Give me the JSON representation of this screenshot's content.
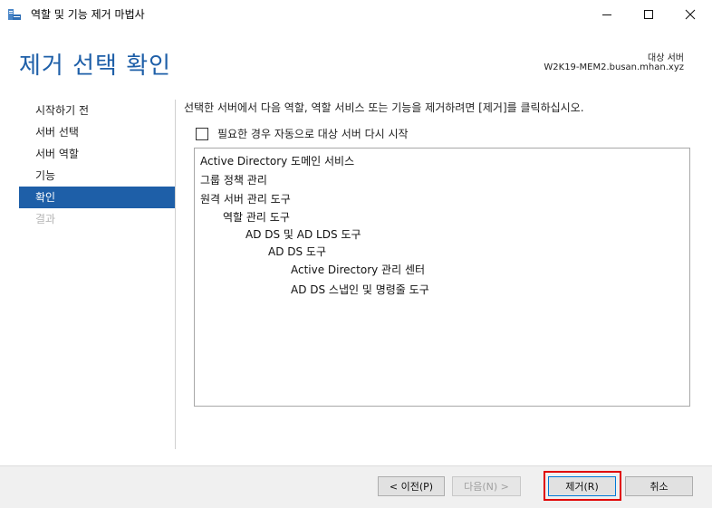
{
  "window": {
    "title": "역할 및 기능 제거 마법사"
  },
  "header": {
    "page_title": "제거 선택 확인",
    "destination_label": "대상 서버",
    "destination_server": "W2K19-MEM2.busan.mhan.xyz"
  },
  "sidebar": {
    "items": [
      {
        "label": "시작하기 전",
        "state": "normal"
      },
      {
        "label": "서버 선택",
        "state": "normal"
      },
      {
        "label": "서버 역할",
        "state": "normal"
      },
      {
        "label": "기능",
        "state": "normal"
      },
      {
        "label": "확인",
        "state": "active"
      },
      {
        "label": "결과",
        "state": "disabled"
      }
    ]
  },
  "main": {
    "instruction": "선택한 서버에서 다음 역할, 역할 서비스 또는 기능을 제거하려면 [제거]를 클릭하십시오.",
    "restart_checkbox": {
      "label": "필요한 경우 자동으로 대상 서버 다시 시작",
      "checked": false
    },
    "removal_items": [
      {
        "text": "Active Directory 도메인 서비스",
        "level": 0
      },
      {
        "text": "그룹 정책 관리",
        "level": 0
      },
      {
        "text": "원격 서버 관리 도구",
        "level": 0
      },
      {
        "text": "역할 관리 도구",
        "level": 1
      },
      {
        "text": "AD DS 및 AD LDS 도구",
        "level": 2
      },
      {
        "text": "AD DS 도구",
        "level": 3
      },
      {
        "text": "Active Directory 관리 센터",
        "level": 4
      },
      {
        "text": "AD DS 스냅인 및 명령줄 도구",
        "level": 4
      }
    ]
  },
  "footer": {
    "prev_label": "< 이전(P)",
    "next_label": "다음(N) >",
    "remove_label": "제거(R)",
    "cancel_label": "취소"
  },
  "colors": {
    "accent": "#1e5fa8",
    "highlight": "#e00000"
  }
}
